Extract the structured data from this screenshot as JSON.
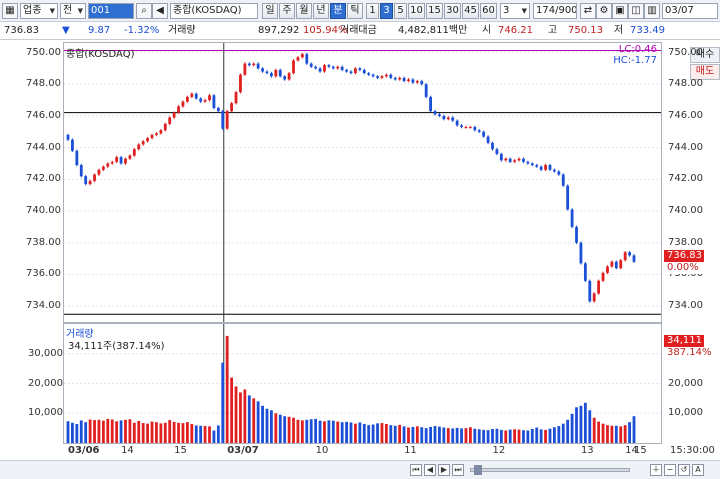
{
  "toolbar": {
    "market_select": "업종",
    "type_select": "전",
    "code_value": "001",
    "name_value": "종합(KOSDAQ)",
    "period_buttons": [
      "일",
      "주",
      "월",
      "년",
      "분",
      "틱"
    ],
    "active_period": "분",
    "interval_buttons": [
      "1",
      "3",
      "5",
      "10",
      "15",
      "30",
      "45",
      "60"
    ],
    "active_interval": "3",
    "interval_select": "3",
    "counter": "174/900",
    "date_value": "03/07"
  },
  "info": {
    "last_price": "736.83",
    "change_arrow": "▼",
    "change": "9.87",
    "change_pct": "-1.32%",
    "volume_label": "거래량",
    "volume": "897,292",
    "volume_ratio": "105.94%",
    "amount_label": "거래대금",
    "amount": "4,482,811백만",
    "open_label": "시",
    "open": "746.21",
    "high_label": "고",
    "high": "750.13",
    "low_label": "저",
    "low": "733.49"
  },
  "side_tabs": {
    "buy": "매수",
    "sell": "매도"
  },
  "price_panel": {
    "title": "종합(KOSDAQ)",
    "lc": "LC:0.46",
    "hc": "HC:-1.77",
    "current_tag": "736.83",
    "current_pct_tag": "0.00%",
    "y_ticks": [
      "750.00",
      "748.00",
      "746.00",
      "744.00",
      "742.00",
      "740.00",
      "738.00",
      "736.00",
      "734.00"
    ],
    "colors": {
      "up": "#e02020",
      "down": "#1a4fd6",
      "hline": "#000000",
      "cursor": "#333333",
      "magenta": "#b000b0"
    }
  },
  "volume_panel": {
    "title": "거래량",
    "info": "34,111주(387.14%)",
    "current_tag": "34,111",
    "current_pct_tag": "387.14%",
    "y_ticks": [
      "30,000",
      "20,000",
      "10,000"
    ]
  },
  "x_axis": {
    "labels": [
      "03/06",
      "14",
      "15",
      "03/07",
      "10",
      "11",
      "12",
      "13",
      "14",
      "15"
    ],
    "time_label": "15:30:00"
  },
  "chart_data": {
    "type": "candlestick",
    "title": "종합(KOSDAQ)",
    "xlabel": "",
    "ylabel": "",
    "ylim": [
      733.0,
      750.6
    ],
    "grid": true,
    "closes": [
      744.5,
      743.8,
      742.9,
      742.2,
      741.7,
      741.9,
      742.3,
      742.6,
      742.8,
      743.0,
      743.1,
      743.4,
      743.0,
      743.3,
      743.5,
      743.9,
      744.2,
      744.4,
      744.6,
      744.8,
      744.9,
      745.1,
      745.5,
      745.9,
      746.2,
      746.6,
      746.9,
      747.2,
      747.4,
      747.1,
      746.9,
      747.0,
      747.3,
      746.5,
      746.3,
      745.2,
      746.3,
      746.8,
      747.5,
      748.6,
      749.3,
      749.2,
      749.3,
      749.0,
      748.8,
      748.7,
      748.5,
      748.9,
      748.5,
      748.3,
      748.7,
      749.5,
      749.7,
      749.9,
      749.3,
      749.1,
      749.0,
      748.8,
      749.2,
      749.1,
      749.0,
      749.1,
      748.9,
      748.8,
      748.7,
      749.0,
      748.9,
      748.7,
      748.6,
      748.5,
      748.4,
      748.5,
      748.6,
      748.4,
      748.3,
      748.4,
      748.2,
      748.3,
      748.1,
      748.2,
      748.0,
      747.2,
      746.3,
      746.1,
      746.0,
      745.8,
      745.9,
      745.7,
      745.4,
      745.3,
      745.3,
      745.3,
      745.1,
      745.0,
      744.7,
      744.3,
      743.9,
      743.6,
      743.2,
      743.3,
      743.1,
      743.2,
      743.3,
      743.1,
      743.0,
      742.9,
      742.8,
      742.6,
      742.9,
      742.6,
      742.5,
      742.3,
      741.6,
      740.1,
      739.0,
      738.0,
      736.7,
      735.6,
      734.3,
      734.8,
      735.6,
      736.1,
      736.5,
      736.8,
      736.4,
      736.9,
      737.4,
      737.2,
      736.8
    ],
    "volumes": [
      7300,
      6800,
      6400,
      7600,
      7000,
      7900,
      7700,
      7800,
      7500,
      8100,
      7900,
      7300,
      7600,
      7800,
      8000,
      6800,
      7400,
      6700,
      6500,
      7200,
      7000,
      6600,
      6800,
      7700,
      7100,
      6800,
      6700,
      7000,
      6400,
      5900,
      5800,
      5700,
      5600,
      4200,
      5900,
      27000,
      36000,
      22000,
      19000,
      17000,
      18000,
      16000,
      15000,
      14000,
      12500,
      11500,
      11000,
      10000,
      9500,
      9000,
      8800,
      8500,
      7800,
      7600,
      7800,
      8000,
      8100,
      7500,
      7300,
      7600,
      7500,
      7200,
      7000,
      7100,
      6900,
      6500,
      6900,
      6400,
      6000,
      6200,
      6600,
      6700,
      6400,
      6000,
      5800,
      6100,
      5600,
      5200,
      5400,
      5600,
      5300,
      5000,
      5400,
      5700,
      5500,
      5200,
      5000,
      4900,
      5100,
      4900,
      5000,
      5300,
      4800,
      4600,
      4400,
      4300,
      4700,
      4800,
      4400,
      4200,
      4500,
      4600,
      4500,
      4300,
      4200,
      4700,
      5200,
      4600,
      4400,
      4800,
      5300,
      5700,
      6500,
      7800,
      9800,
      12000,
      12500,
      13500,
      11000,
      8500,
      7200,
      6500,
      6000,
      5800,
      5800,
      5600,
      6000,
      7000,
      9000,
      34111
    ]
  }
}
